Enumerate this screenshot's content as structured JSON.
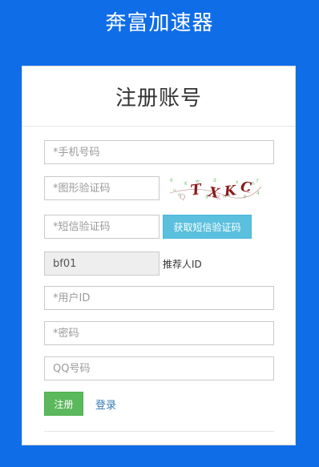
{
  "app": {
    "title": "奔富加速器"
  },
  "card": {
    "title": "注册账号"
  },
  "form": {
    "phone_placeholder": "*手机号码",
    "captcha_placeholder": "*图形验证码",
    "captcha_text": "TXKC",
    "sms_placeholder": "*短信验证码",
    "sms_button": "获取短信验证码",
    "referrer_value": "bf01",
    "referrer_label": "推荐人ID",
    "userid_placeholder": "*用户ID",
    "password_placeholder": "*密码",
    "qq_placeholder": "QQ号码",
    "register_button": "注册",
    "login_link": "登录"
  },
  "colors": {
    "background": "#0f6de8",
    "sms_button": "#5bc0de",
    "register_button": "#5cb85c",
    "link": "#337ab7"
  }
}
